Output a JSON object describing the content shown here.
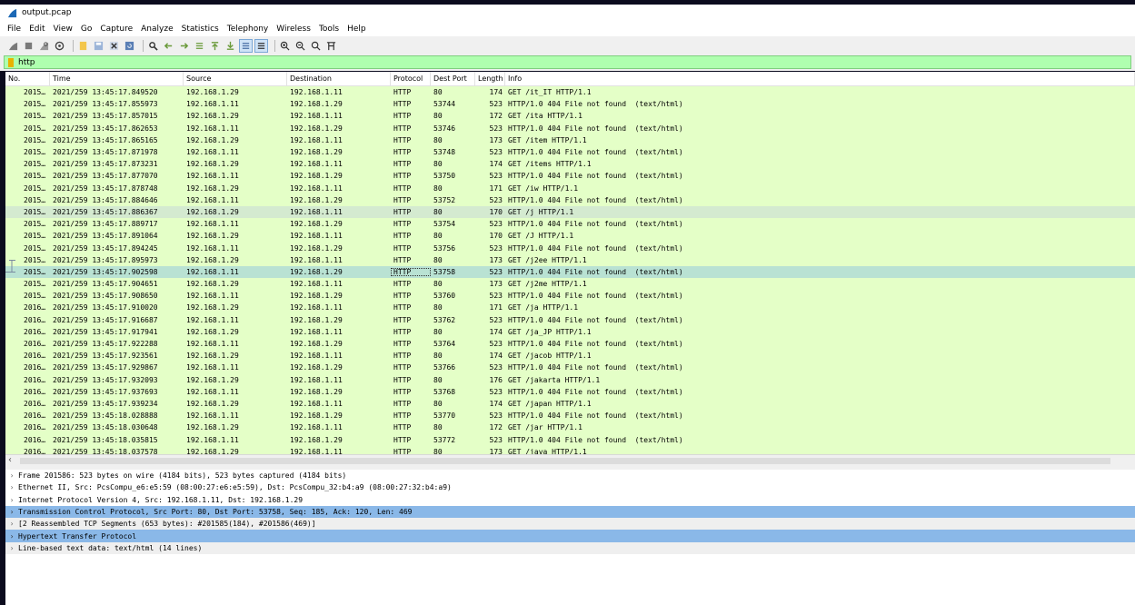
{
  "window": {
    "title": "output.pcap"
  },
  "menu": [
    "File",
    "Edit",
    "View",
    "Go",
    "Capture",
    "Analyze",
    "Statistics",
    "Telephony",
    "Wireless",
    "Tools",
    "Help"
  ],
  "toolbar": {
    "icons": [
      "shark-fin-start-icon",
      "stop-icon",
      "restart-icon",
      "capture-options-icon",
      "open-file-icon",
      "save-file-icon",
      "close-file-icon",
      "reload-icon",
      "find-packet-icon",
      "go-back-icon",
      "go-forward-icon",
      "go-to-packet-icon",
      "go-first-icon",
      "go-last-icon",
      "autoscroll-icon",
      "colorize-icon",
      "zoom-in-icon",
      "zoom-out-icon",
      "zoom-reset-icon",
      "resize-columns-icon"
    ]
  },
  "filter": {
    "value": "http"
  },
  "columns": {
    "no": "No.",
    "time": "Time",
    "source": "Source",
    "destination": "Destination",
    "protocol": "Protocol",
    "dest_port": "Dest Port",
    "length": "Length",
    "info": "Info"
  },
  "packets": [
    {
      "no": "2015…",
      "time": "2021/259 13:45:17.849520",
      "src": "192.168.1.29",
      "dst": "192.168.1.11",
      "proto": "HTTP",
      "port": "80",
      "len": "174",
      "info": "GET /it_IT HTTP/1.1"
    },
    {
      "no": "2015…",
      "time": "2021/259 13:45:17.855973",
      "src": "192.168.1.11",
      "dst": "192.168.1.29",
      "proto": "HTTP",
      "port": "53744",
      "len": "523",
      "info": "HTTP/1.0 404 File not found  (text/html)"
    },
    {
      "no": "2015…",
      "time": "2021/259 13:45:17.857015",
      "src": "192.168.1.29",
      "dst": "192.168.1.11",
      "proto": "HTTP",
      "port": "80",
      "len": "172",
      "info": "GET /ita HTTP/1.1"
    },
    {
      "no": "2015…",
      "time": "2021/259 13:45:17.862653",
      "src": "192.168.1.11",
      "dst": "192.168.1.29",
      "proto": "HTTP",
      "port": "53746",
      "len": "523",
      "info": "HTTP/1.0 404 File not found  (text/html)"
    },
    {
      "no": "2015…",
      "time": "2021/259 13:45:17.865165",
      "src": "192.168.1.29",
      "dst": "192.168.1.11",
      "proto": "HTTP",
      "port": "80",
      "len": "173",
      "info": "GET /item HTTP/1.1"
    },
    {
      "no": "2015…",
      "time": "2021/259 13:45:17.871978",
      "src": "192.168.1.11",
      "dst": "192.168.1.29",
      "proto": "HTTP",
      "port": "53748",
      "len": "523",
      "info": "HTTP/1.0 404 File not found  (text/html)"
    },
    {
      "no": "2015…",
      "time": "2021/259 13:45:17.873231",
      "src": "192.168.1.29",
      "dst": "192.168.1.11",
      "proto": "HTTP",
      "port": "80",
      "len": "174",
      "info": "GET /items HTTP/1.1"
    },
    {
      "no": "2015…",
      "time": "2021/259 13:45:17.877070",
      "src": "192.168.1.11",
      "dst": "192.168.1.29",
      "proto": "HTTP",
      "port": "53750",
      "len": "523",
      "info": "HTTP/1.0 404 File not found  (text/html)"
    },
    {
      "no": "2015…",
      "time": "2021/259 13:45:17.878748",
      "src": "192.168.1.29",
      "dst": "192.168.1.11",
      "proto": "HTTP",
      "port": "80",
      "len": "171",
      "info": "GET /iw HTTP/1.1"
    },
    {
      "no": "2015…",
      "time": "2021/259 13:45:17.884646",
      "src": "192.168.1.11",
      "dst": "192.168.1.29",
      "proto": "HTTP",
      "port": "53752",
      "len": "523",
      "info": "HTTP/1.0 404 File not found  (text/html)"
    },
    {
      "no": "2015…",
      "time": "2021/259 13:45:17.886367",
      "src": "192.168.1.29",
      "dst": "192.168.1.11",
      "proto": "HTTP",
      "port": "80",
      "len": "170",
      "info": "GET /j HTTP/1.1",
      "state": "sel-light"
    },
    {
      "no": "2015…",
      "time": "2021/259 13:45:17.889717",
      "src": "192.168.1.11",
      "dst": "192.168.1.29",
      "proto": "HTTP",
      "port": "53754",
      "len": "523",
      "info": "HTTP/1.0 404 File not found  (text/html)"
    },
    {
      "no": "2015…",
      "time": "2021/259 13:45:17.891064",
      "src": "192.168.1.29",
      "dst": "192.168.1.11",
      "proto": "HTTP",
      "port": "80",
      "len": "170",
      "info": "GET /J HTTP/1.1"
    },
    {
      "no": "2015…",
      "time": "2021/259 13:45:17.894245",
      "src": "192.168.1.11",
      "dst": "192.168.1.29",
      "proto": "HTTP",
      "port": "53756",
      "len": "523",
      "info": "HTTP/1.0 404 File not found  (text/html)"
    },
    {
      "no": "2015…",
      "time": "2021/259 13:45:17.895973",
      "src": "192.168.1.29",
      "dst": "192.168.1.11",
      "proto": "HTTP",
      "port": "80",
      "len": "173",
      "info": "GET /j2ee HTTP/1.1",
      "mark": "related-request"
    },
    {
      "no": "2015…",
      "time": "2021/259 13:45:17.902598",
      "src": "192.168.1.11",
      "dst": "192.168.1.29",
      "proto": "HTTP",
      "port": "53758",
      "len": "523",
      "info": "HTTP/1.0 404 File not found  (text/html)",
      "state": "sel",
      "mark": "related-response"
    },
    {
      "no": "2015…",
      "time": "2021/259 13:45:17.904651",
      "src": "192.168.1.29",
      "dst": "192.168.1.11",
      "proto": "HTTP",
      "port": "80",
      "len": "173",
      "info": "GET /j2me HTTP/1.1"
    },
    {
      "no": "2015…",
      "time": "2021/259 13:45:17.908650",
      "src": "192.168.1.11",
      "dst": "192.168.1.29",
      "proto": "HTTP",
      "port": "53760",
      "len": "523",
      "info": "HTTP/1.0 404 File not found  (text/html)"
    },
    {
      "no": "2016…",
      "time": "2021/259 13:45:17.910020",
      "src": "192.168.1.29",
      "dst": "192.168.1.11",
      "proto": "HTTP",
      "port": "80",
      "len": "171",
      "info": "GET /ja HTTP/1.1"
    },
    {
      "no": "2016…",
      "time": "2021/259 13:45:17.916687",
      "src": "192.168.1.11",
      "dst": "192.168.1.29",
      "proto": "HTTP",
      "port": "53762",
      "len": "523",
      "info": "HTTP/1.0 404 File not found  (text/html)"
    },
    {
      "no": "2016…",
      "time": "2021/259 13:45:17.917941",
      "src": "192.168.1.29",
      "dst": "192.168.1.11",
      "proto": "HTTP",
      "port": "80",
      "len": "174",
      "info": "GET /ja_JP HTTP/1.1"
    },
    {
      "no": "2016…",
      "time": "2021/259 13:45:17.922288",
      "src": "192.168.1.11",
      "dst": "192.168.1.29",
      "proto": "HTTP",
      "port": "53764",
      "len": "523",
      "info": "HTTP/1.0 404 File not found  (text/html)"
    },
    {
      "no": "2016…",
      "time": "2021/259 13:45:17.923561",
      "src": "192.168.1.29",
      "dst": "192.168.1.11",
      "proto": "HTTP",
      "port": "80",
      "len": "174",
      "info": "GET /jacob HTTP/1.1"
    },
    {
      "no": "2016…",
      "time": "2021/259 13:45:17.929867",
      "src": "192.168.1.11",
      "dst": "192.168.1.29",
      "proto": "HTTP",
      "port": "53766",
      "len": "523",
      "info": "HTTP/1.0 404 File not found  (text/html)"
    },
    {
      "no": "2016…",
      "time": "2021/259 13:45:17.932093",
      "src": "192.168.1.29",
      "dst": "192.168.1.11",
      "proto": "HTTP",
      "port": "80",
      "len": "176",
      "info": "GET /jakarta HTTP/1.1"
    },
    {
      "no": "2016…",
      "time": "2021/259 13:45:17.937693",
      "src": "192.168.1.11",
      "dst": "192.168.1.29",
      "proto": "HTTP",
      "port": "53768",
      "len": "523",
      "info": "HTTP/1.0 404 File not found  (text/html)"
    },
    {
      "no": "2016…",
      "time": "2021/259 13:45:17.939234",
      "src": "192.168.1.29",
      "dst": "192.168.1.11",
      "proto": "HTTP",
      "port": "80",
      "len": "174",
      "info": "GET /japan HTTP/1.1"
    },
    {
      "no": "2016…",
      "time": "2021/259 13:45:18.028888",
      "src": "192.168.1.11",
      "dst": "192.168.1.29",
      "proto": "HTTP",
      "port": "53770",
      "len": "523",
      "info": "HTTP/1.0 404 File not found  (text/html)"
    },
    {
      "no": "2016…",
      "time": "2021/259 13:45:18.030648",
      "src": "192.168.1.29",
      "dst": "192.168.1.11",
      "proto": "HTTP",
      "port": "80",
      "len": "172",
      "info": "GET /jar HTTP/1.1"
    },
    {
      "no": "2016…",
      "time": "2021/259 13:45:18.035815",
      "src": "192.168.1.11",
      "dst": "192.168.1.29",
      "proto": "HTTP",
      "port": "53772",
      "len": "523",
      "info": "HTTP/1.0 404 File not found  (text/html)"
    },
    {
      "no": "2016…",
      "time": "2021/259 13:45:18.037578",
      "src": "192.168.1.29",
      "dst": "192.168.1.11",
      "proto": "HTTP",
      "port": "80",
      "len": "173",
      "info": "GET /java HTTP/1.1"
    }
  ],
  "details": [
    {
      "text": "Frame 201586: 523 bytes on wire (4184 bits), 523 bytes captured (4184 bits)",
      "style": ""
    },
    {
      "text": "Ethernet II, Src: PcsCompu_e6:e5:59 (08:00:27:e6:e5:59), Dst: PcsCompu_32:b4:a9 (08:00:27:32:b4:a9)",
      "style": ""
    },
    {
      "text": "Internet Protocol Version 4, Src: 192.168.1.11, Dst: 192.168.1.29",
      "style": ""
    },
    {
      "text": "Transmission Control Protocol, Src Port: 80, Dst Port: 53758, Seq: 185, Ack: 120, Len: 469",
      "style": "hl"
    },
    {
      "text": "[2 Reassembled TCP Segments (653 bytes): #201585(184), #201586(469)]",
      "style": "gray"
    },
    {
      "text": "Hypertext Transfer Protocol",
      "style": "hl"
    },
    {
      "text": "Line-based text data: text/html (14 lines)",
      "style": "gray"
    }
  ],
  "colors": {
    "http_row": "#e4ffc7",
    "selected_row": "#b9e2d3",
    "filter_bg": "#afffaf",
    "detail_highlight": "#8ab8e8"
  }
}
